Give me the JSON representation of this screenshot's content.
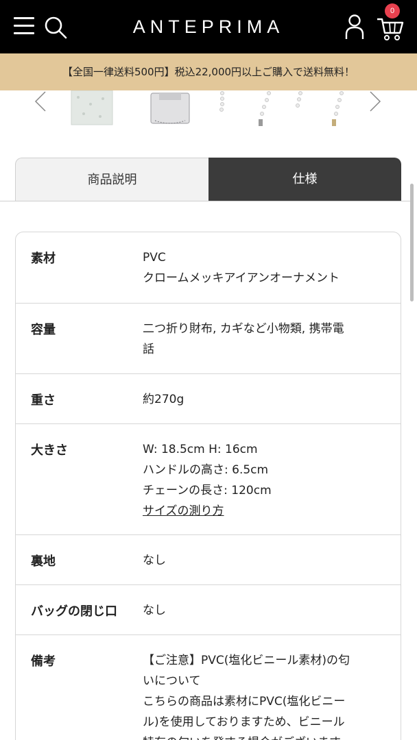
{
  "header": {
    "brand": "ANTEPRIMA",
    "cart_count": "0",
    "icons": [
      "menu-icon",
      "search-icon",
      "user-icon",
      "cart-icon"
    ]
  },
  "promo": {
    "text": "【全国一律送料500円】税込22,000円以上ご購入で送料無料！"
  },
  "carousel": {
    "thumbnails": [
      "clear-beaded-bag",
      "silver-clutch-bag",
      "pearl-chain",
      "pearl-chain",
      "pearl-chain",
      "pearl-chain"
    ]
  },
  "tabs": [
    {
      "label": "商品説明",
      "active": false
    },
    {
      "label": "仕様",
      "active": true
    }
  ],
  "spec": {
    "material_label": "素材",
    "material_lines": [
      "PVC",
      "クロームメッキアイアンオーナメント"
    ],
    "capacity_label": "容量",
    "capacity_lines": [
      "二つ折り財布, カギなど小物類, 携帯電",
      "話"
    ],
    "weight_label": "重さ",
    "weight_value": "約270g",
    "size_label": "大きさ",
    "size_lines": [
      "W: 18.5cm H: 16cm",
      "ハンドルの高さ: 6.5cm",
      "チェーンの長さ: 120cm"
    ],
    "size_link": "サイズの測り方",
    "lining_label": "裏地",
    "lining_value": "なし",
    "closure_label": "バッグの閉じ口",
    "closure_value": "なし",
    "notes_label": "備考",
    "notes_lines": [
      "【ご注意】PVC(塩化ビニール素材)の匂",
      "いについて",
      "こちらの商品は素材にPVC(塩化ビニー",
      "ル)を使用しておりますため、ビニール",
      "特有の匂いを発する場合がございます"
    ]
  },
  "colors": {
    "header_bg": "#000000",
    "promo_bg": "#e2c799",
    "active_tab_bg": "#3b3b3b",
    "badge": "#e8414f"
  }
}
